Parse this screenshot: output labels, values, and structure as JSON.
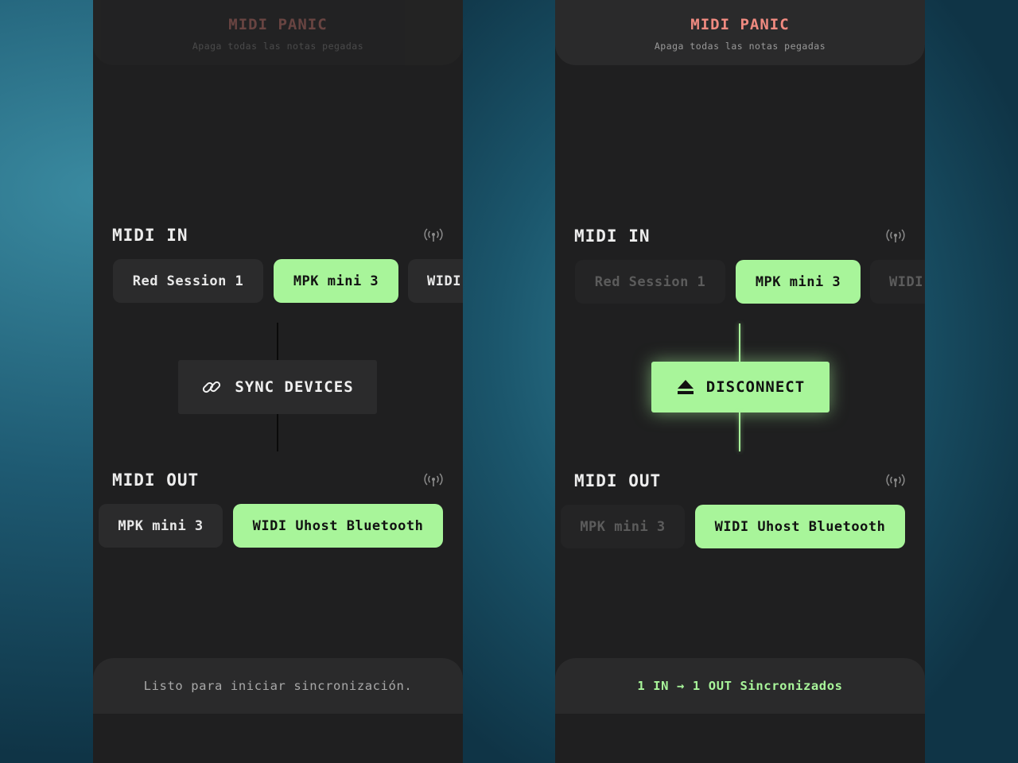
{
  "panic": {
    "title": "MIDI PANIC",
    "subtitle": "Apaga todas las notas pegadas"
  },
  "left": {
    "midi_in": {
      "title": "MIDI IN",
      "devices": [
        "Red Session 1",
        "MPK mini 3",
        "WIDI"
      ],
      "selected": "MPK mini 3"
    },
    "action_label": "SYNC DEVICES",
    "midi_out": {
      "title": "MIDI OUT",
      "devices": [
        "MPK mini 3",
        "WIDI Uhost Bluetooth"
      ],
      "selected": "WIDI Uhost Bluetooth"
    },
    "status": "Listo para iniciar sincronización."
  },
  "right": {
    "midi_in": {
      "title": "MIDI IN",
      "devices": [
        "Red Session 1",
        "MPK mini 3",
        "WIDI"
      ],
      "selected": "MPK mini 3"
    },
    "action_label": "DISCONNECT",
    "midi_out": {
      "title": "MIDI OUT",
      "devices": [
        "MPK mini 3",
        "WIDI Uhost Bluetooth"
      ],
      "selected": "WIDI Uhost Bluetooth"
    },
    "status": "1 IN → 1 OUT Sincronizados"
  },
  "icons": {
    "signal": "antenna-signal-icon",
    "sync": "link-icon",
    "disconnect": "eject-icon"
  },
  "colors": {
    "accent_green": "#a8f59a",
    "panic_red": "#f08a80",
    "panel": "#1f1f20",
    "chip": "#2b2b2c"
  }
}
